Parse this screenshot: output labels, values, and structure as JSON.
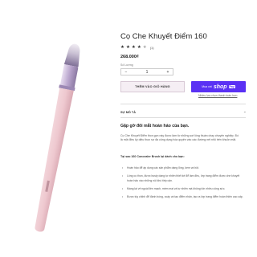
{
  "product": {
    "title": "Cọ Che Khuyết Điểm 160",
    "rating": 4,
    "rating_max": 5,
    "rating_count": "(1)",
    "price": "268.000₫"
  },
  "quantity": {
    "label": "Số Lượng",
    "minus": "−",
    "value": "1",
    "plus": "+"
  },
  "actions": {
    "add_to_cart": "THÊM VÀO GIỎ HÀNG",
    "shoppay_prefix": "Mua với",
    "shoppay_shop": "shop",
    "shoppay_pay": "Pay",
    "more_payment": "Nhiều lựa chọn thanh toán hơn"
  },
  "description": {
    "section_label": "SỰ MÔ TẢ",
    "toggle": "−",
    "heading": "Gặp gỡ đôi mắt hoàn hảo của bạn.",
    "paragraph": "Cọ Che Khuyết Điểm thon gọn này được làm từ những sợi lông thuần chay chuyên nghiệp. Đó là một điều kỳ diệu thực sự đa công dụng hòa quyện vào các đường nét nhỏ trên khuôn mặt.",
    "subheading": "Tại sao 160 Concealer Brush lại dành cho bạn:",
    "bullets": [
      "Hoàn hảo để áp dụng các sản phẩm dạng lỏng, kem và bột.",
      "Lông cọ thon, được busty dạng tự nhiên thiết kế để làm đều, lớp trang điểm được che khuyết hoàn hảo vào những nội khó tiếp cận.",
      "Mang lại vẻ ngoài liền mạch, mềm mại và tự nhiên mà không tốn nhiều công sức.",
      "Được tùy chỉnh để đánh bóng, xoáy và tạo điểm nhấn, tạo ra lớp trang điểm hoàn thiện cao cấp."
    ]
  },
  "colors": {
    "brush_handle": "#eec8cf",
    "brush_ferrule": "#b8a4cc",
    "brush_bristle": "#8d7fa3",
    "add_to_cart_bg": "#f5eef4",
    "shoppay_bg": "#5a31f4"
  }
}
